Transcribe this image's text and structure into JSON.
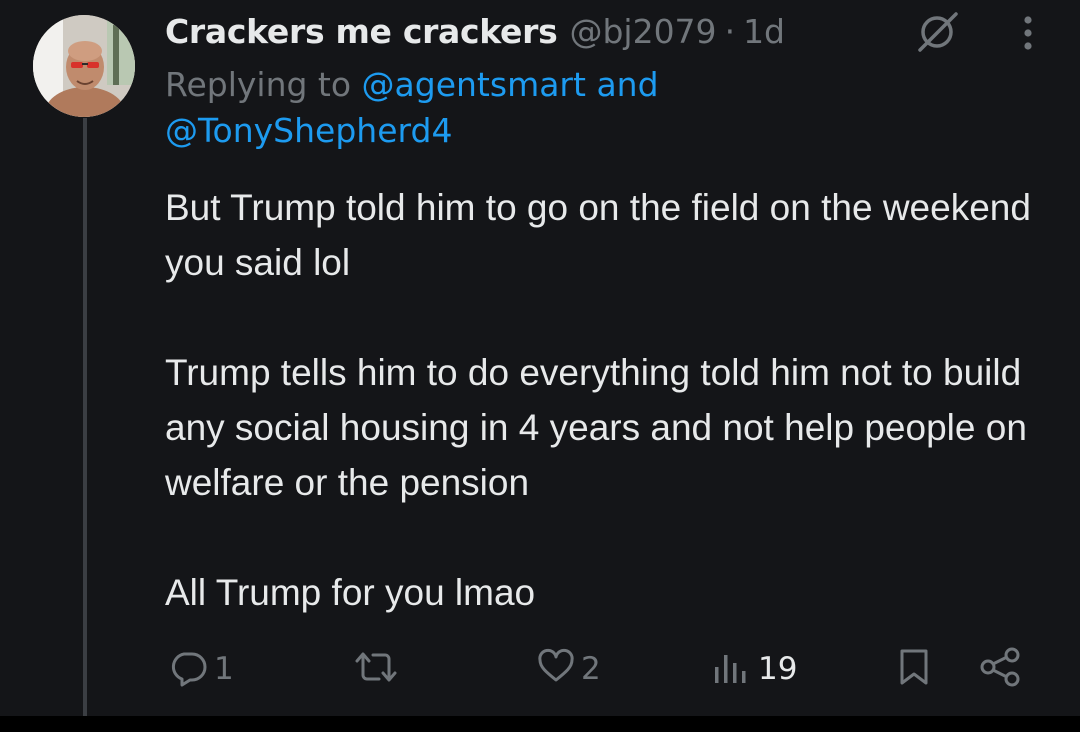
{
  "tweet": {
    "display_name": "Crackers me crackers",
    "handle": "@bj2079",
    "separator": "·",
    "time": "1d",
    "replying_prefix": "Replying to",
    "mention_1": "@agentsmart",
    "and_word": "and",
    "mention_2": "@TonyShepherd4",
    "body": [
      "But Trump told him to go on the field on the weekend you said lol",
      "Trump tells him to do everything told him not to build any social housing in 4 years and not help people on welfare or the pension",
      "All Trump for you lmao"
    ]
  },
  "actions": {
    "replies": "1",
    "retweets": "",
    "likes": "2",
    "views": "19"
  },
  "icons": {
    "grok": "grok-icon",
    "more": "more-vertical-icon",
    "reply": "reply-icon",
    "retweet": "retweet-icon",
    "like": "heart-icon",
    "views": "views-icon",
    "bookmark": "bookmark-icon",
    "share": "share-icon"
  },
  "colors": {
    "background": "#141518",
    "text": "#e7e9ea",
    "muted": "#71767b",
    "link": "#1d9bf0"
  }
}
